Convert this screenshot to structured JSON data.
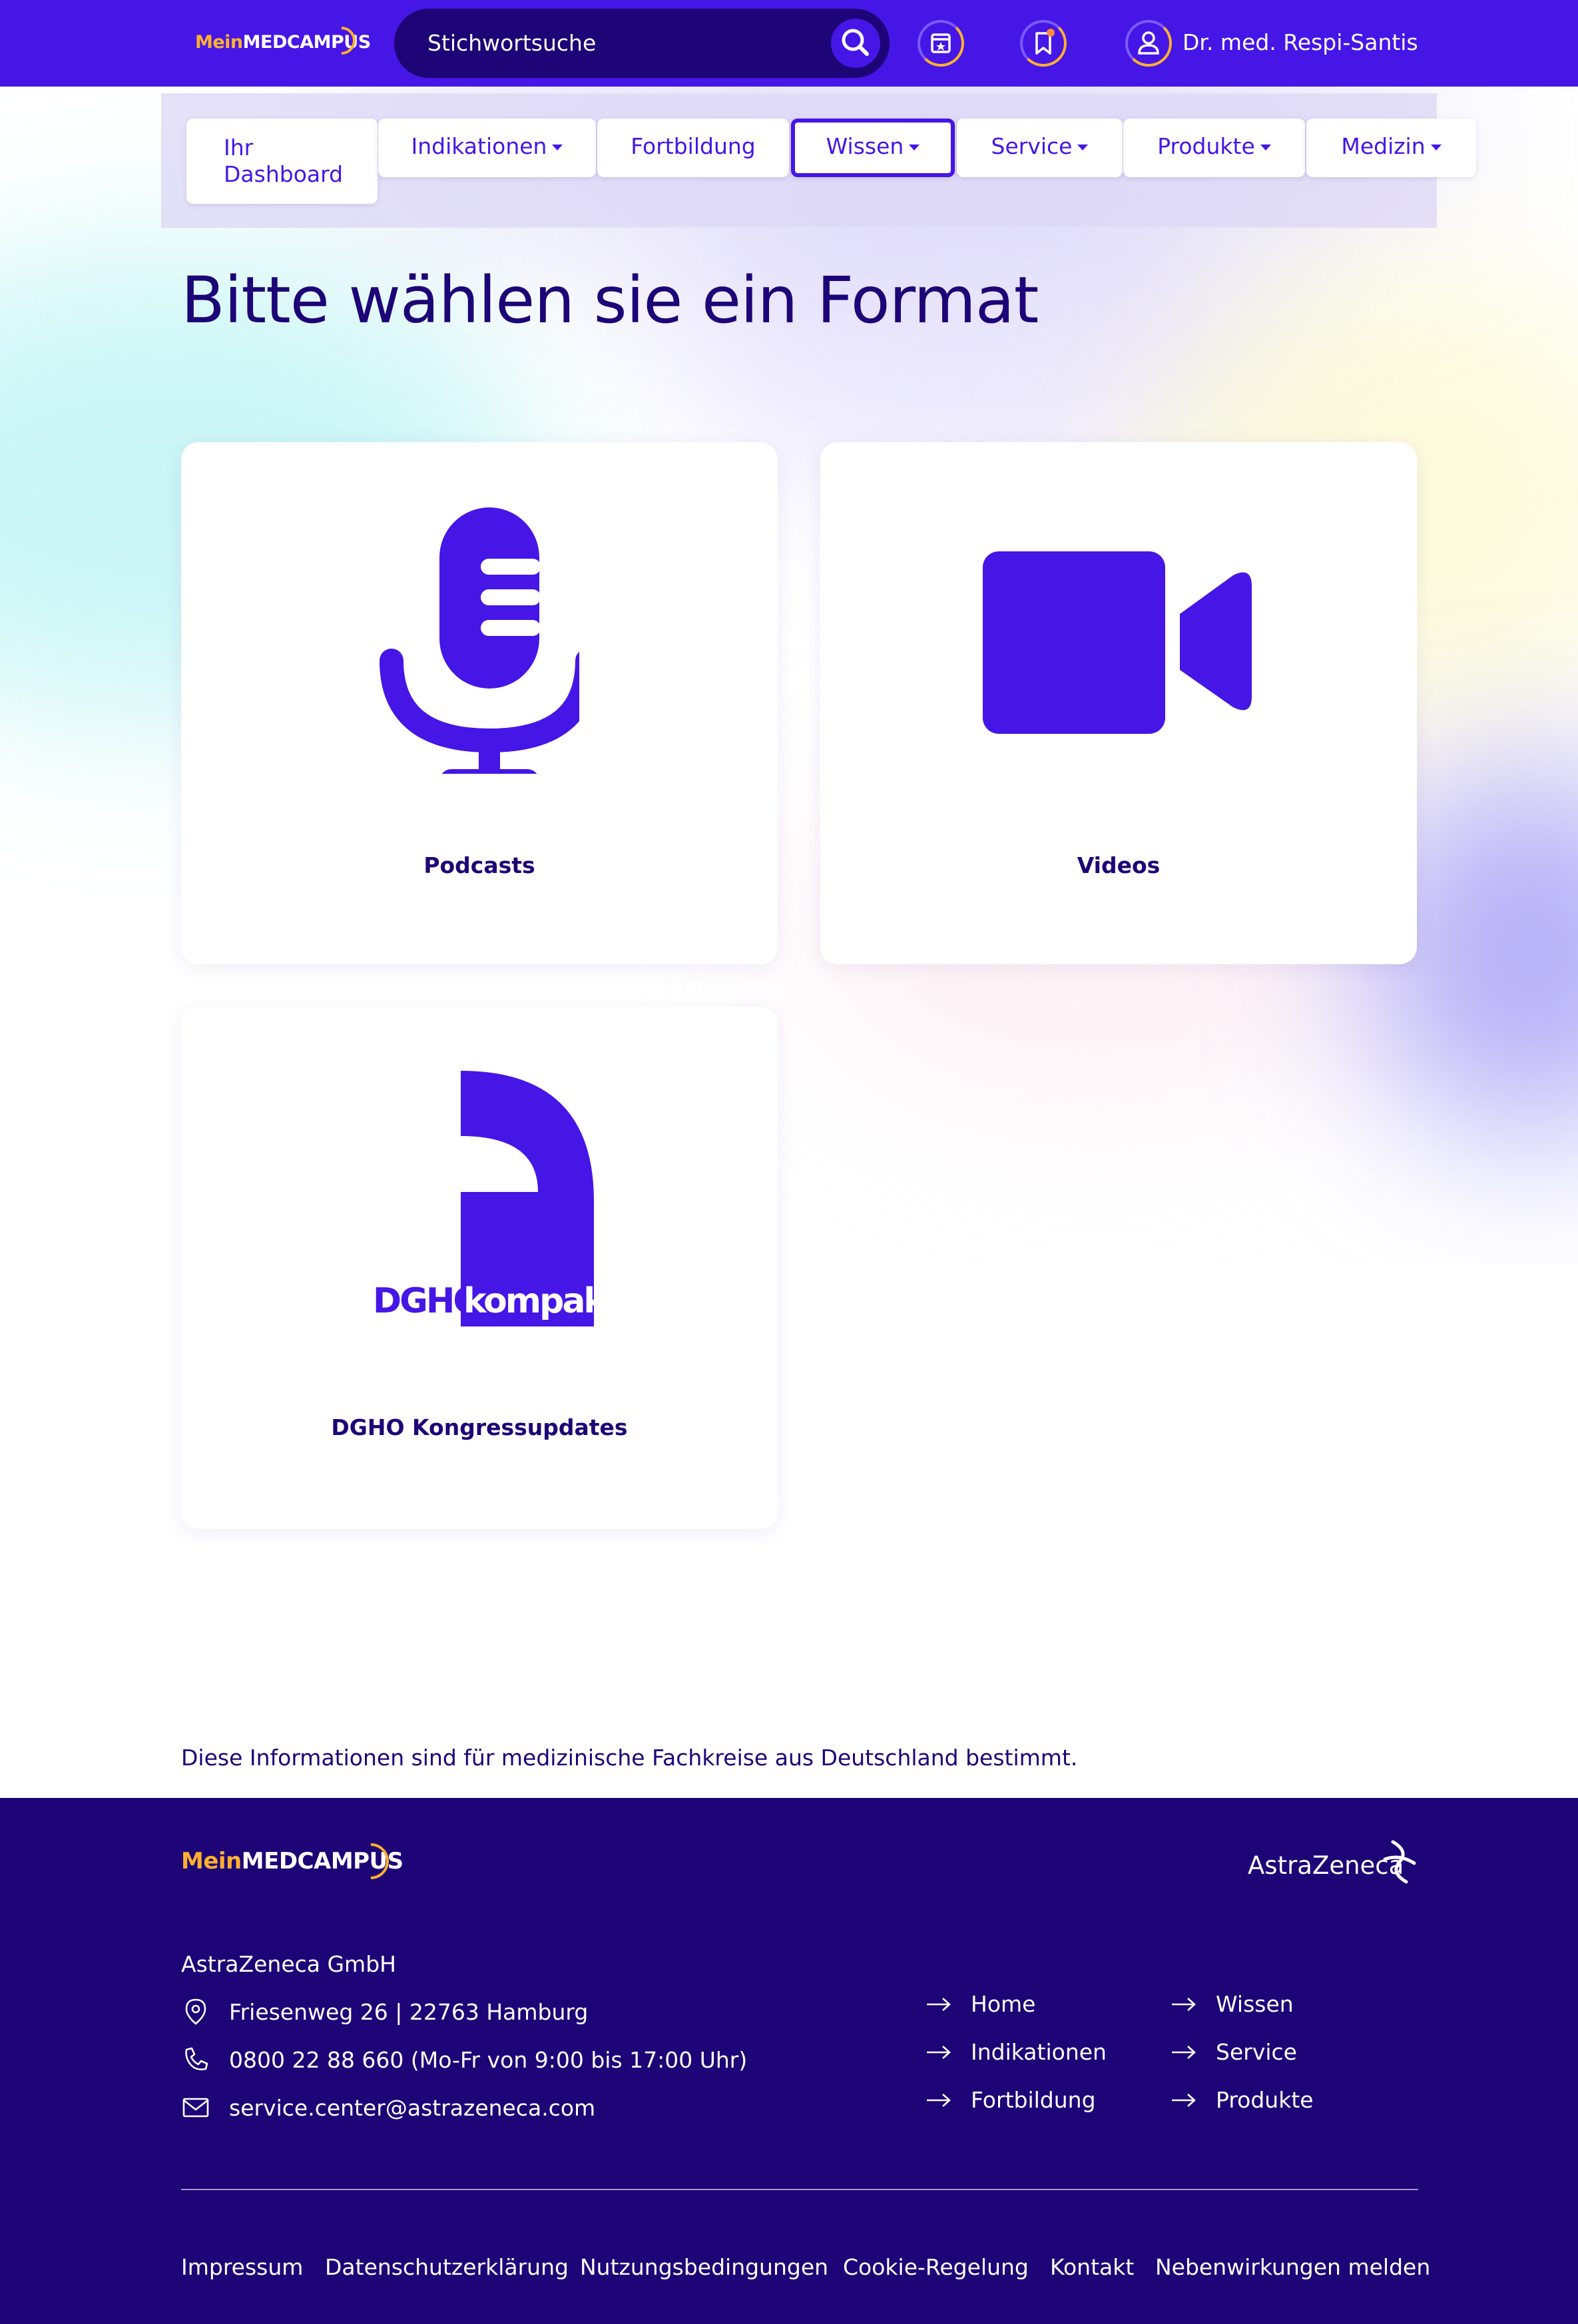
{
  "header": {
    "logo_mein": "Mein",
    "logo_med": "MEDCAMPUS",
    "search_placeholder": "Stichwortsuche",
    "user_name": "Dr. med. Respi-Santis"
  },
  "nav": {
    "items": [
      {
        "label": "Ihr Dashboard"
      },
      {
        "label": "Indikationen"
      },
      {
        "label": "Fortbildung"
      },
      {
        "label": "Wissen"
      },
      {
        "label": "Service"
      },
      {
        "label": "Produkte"
      },
      {
        "label": "Medizin"
      }
    ]
  },
  "main": {
    "title": "Bitte wählen sie ein Format",
    "cards": [
      {
        "label": "Podcasts",
        "icon": "microphone-icon"
      },
      {
        "label": "Videos",
        "icon": "video-camera-icon"
      },
      {
        "label": "DGHO Kongressupdates",
        "icon": "dgho-kompakt-logo"
      }
    ],
    "dgho_logo_dgho": "DGHO",
    "dgho_logo_kompakt": "kompakt"
  },
  "disclaimer": "Diese Informationen sind für medizinische Fachkreise aus Deutschland bestimmt.",
  "footer": {
    "logo_mein": "Mein",
    "logo_med": "MEDCAMPUS",
    "partner_logo": "AstraZeneca",
    "company": "AstraZeneca GmbH",
    "address": "Friesenweg 26 | 22763 Hamburg",
    "phone": "0800 22 88 660 (Mo-Fr von 9:00 bis 17:00 Uhr)",
    "email": "service.center@astrazeneca.com",
    "links_col1": [
      "Home",
      "Indikationen",
      "Fortbildung"
    ],
    "links_col2": [
      "Wissen",
      "Service",
      "Produkte"
    ],
    "legal_links": [
      "Impressum",
      "Datenschutzerklärung",
      "Nutzungsbedingungen",
      "Cookie-Regelung",
      "Kontakt",
      "Nebenwirkungen melden"
    ]
  },
  "colors": {
    "primary": "#4516e6",
    "dark": "#1d0477",
    "accent": "#ffb02e",
    "white": "#ffffff"
  }
}
